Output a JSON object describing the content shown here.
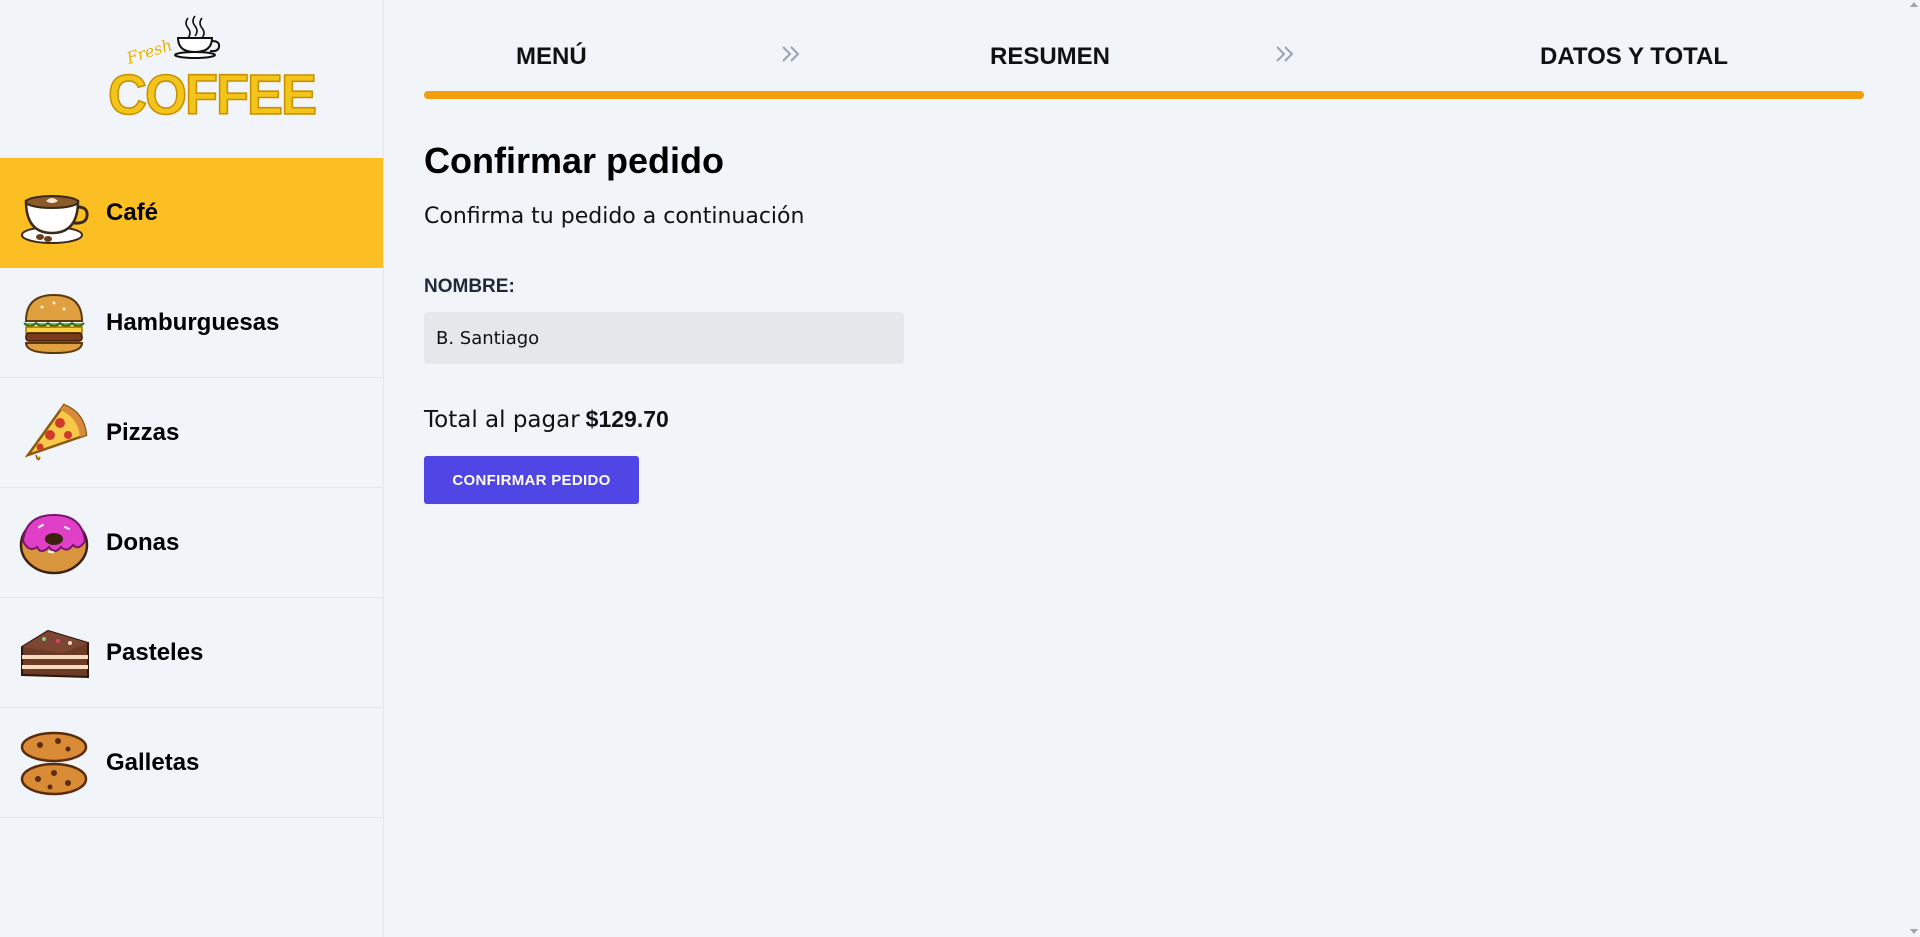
{
  "brand": {
    "logo_script": "Fresh",
    "logo_word": "COFFEE",
    "logo_color": "#f3c41a"
  },
  "sidebar": {
    "items": [
      {
        "label": "Café",
        "icon": "coffee-cup-icon",
        "active": true
      },
      {
        "label": "Hamburguesas",
        "icon": "burger-icon",
        "active": false
      },
      {
        "label": "Pizzas",
        "icon": "pizza-slice-icon",
        "active": false
      },
      {
        "label": "Donas",
        "icon": "donut-icon",
        "active": false
      },
      {
        "label": "Pasteles",
        "icon": "cake-slice-icon",
        "active": false
      },
      {
        "label": "Galletas",
        "icon": "cookies-icon",
        "active": false
      }
    ],
    "active_color": "#fbbf24"
  },
  "steps": {
    "items": [
      "MENÚ",
      "RESUMEN",
      "DATOS Y TOTAL"
    ],
    "arrow_icon": "double-chevron-right-icon",
    "progress": 1.0,
    "progress_color": "#f59e0b"
  },
  "form": {
    "title": "Confirmar pedido",
    "subtitle": "Confirma tu pedido a continuación",
    "name_label": "NOMBRE:",
    "name_value": "B. Santiago",
    "total_label": "Total al pagar",
    "total_amount": "$129.70",
    "confirm_label": "CONFIRMAR PEDIDO",
    "button_color": "#4f46e5"
  }
}
